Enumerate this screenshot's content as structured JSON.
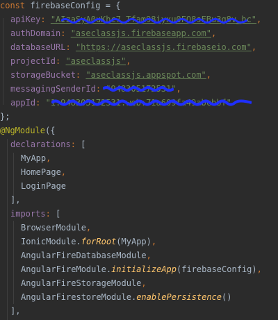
{
  "code": {
    "line1": {
      "keyword": "const",
      "name": "firebaseConfig",
      "eq": "=",
      "open": "{"
    },
    "config": [
      {
        "key": "apiKey",
        "value": "\"AIzaSyA0uKhc7_Tfam98iyxu0FO8sFBu3g8v_hc\""
      },
      {
        "key": "authDomain",
        "value": "\"aseclassjs.firebaseapp.com\""
      },
      {
        "key": "databaseURL",
        "value": "\"https://aseclassjs.firebaseio.com\""
      },
      {
        "key": "projectId",
        "value": "\"aseclassjs\""
      },
      {
        "key": "storageBucket",
        "value": "\"aseclassjs.appspot.com\""
      },
      {
        "key": "messagingSenderId",
        "value": "\"948305172531\""
      },
      {
        "key": "appId",
        "value": "\"1:948305172531:web:71a609fa49abcbbf\""
      }
    ],
    "close_config": "};",
    "decorator": "@NgModule",
    "decorator_open": "({",
    "declarations_key": "declarations",
    "declarations_open": "[",
    "declarations": [
      "MyApp",
      "HomePage",
      "LoginPage"
    ],
    "declarations_close": "],",
    "imports_key": "imports",
    "imports_open": "[",
    "imports": {
      "browser": "BrowserModule",
      "ionic": "IonicModule",
      "ionic_fn": "forRoot",
      "ionic_arg": "MyApp",
      "afdb": "AngularFireDatabaseModule",
      "af": "AngularFireModule",
      "af_fn": "initializeApp",
      "af_arg": "firebaseConfig",
      "afstorage": "AngularFireStorageModule",
      "afs": "AngularFirestoreModule",
      "afs_fn": "enablePersistence",
      "afs_arg": "()"
    },
    "imports_close": "],"
  },
  "colors": {
    "background": "#2b2b2b",
    "keyword": "#cc7832",
    "string": "#6a8759",
    "property": "#9876aa",
    "decorator": "#bbb529",
    "function": "#ffc66d",
    "plain": "#a9b7c6",
    "redaction": "#1f2fff"
  }
}
